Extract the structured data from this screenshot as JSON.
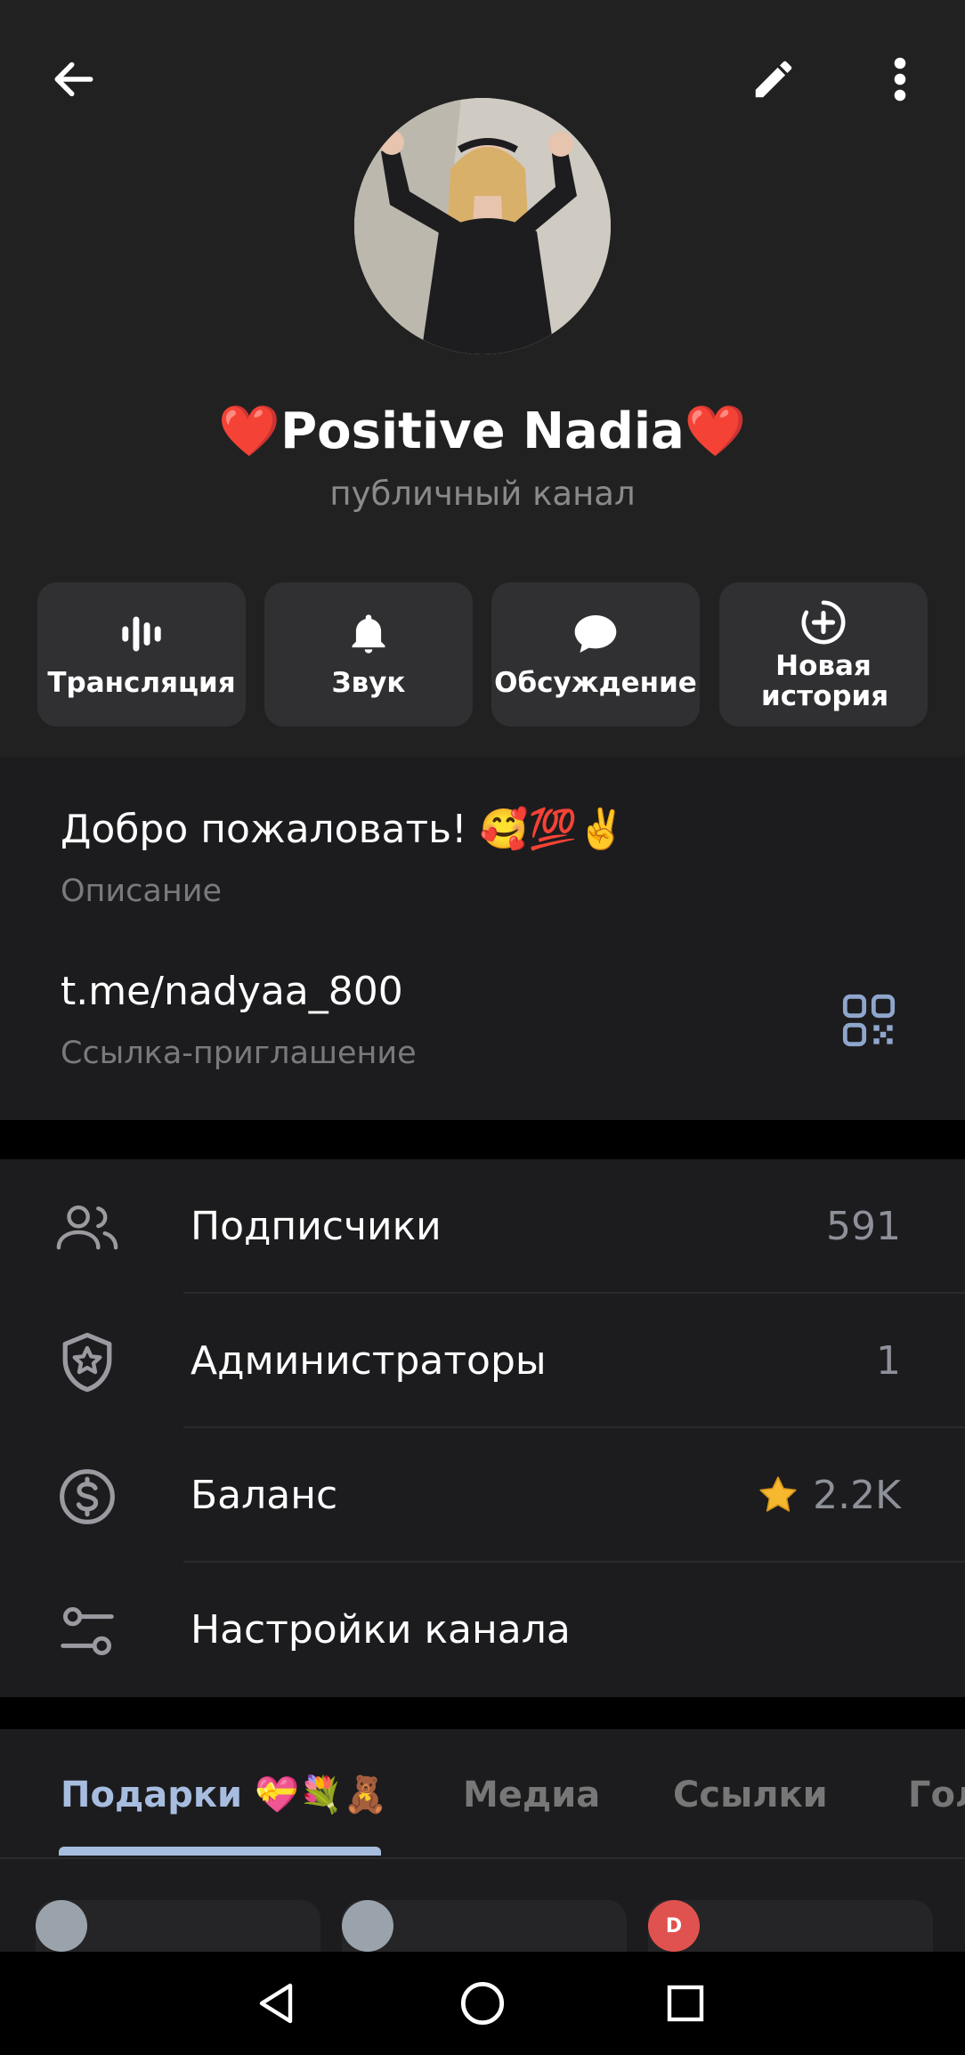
{
  "channel": {
    "name": "❤️Positive Nadia❤️",
    "type": "публичный канал"
  },
  "actions": [
    {
      "label": "Трансляция",
      "icon": "live-stream-icon"
    },
    {
      "label": "Звук",
      "icon": "bell-icon"
    },
    {
      "label": "Обсуждение",
      "icon": "chat-bubble-icon"
    },
    {
      "label": "Новая история",
      "icon": "add-story-icon"
    }
  ],
  "info": {
    "description": "Добро пожаловать! 🥰💯✌️",
    "description_label": "Описание",
    "link": "t.me/nadyaa_800",
    "link_label": "Ссылка-приглашение"
  },
  "list": [
    {
      "label": "Подписчики",
      "value": "591",
      "icon": "users-icon"
    },
    {
      "label": "Администраторы",
      "value": "1",
      "icon": "shield-star-icon"
    },
    {
      "label": "Баланс",
      "value": "2.2K",
      "icon": "dollar-icon"
    },
    {
      "label": "Настройки канала",
      "value": "",
      "icon": "sliders-icon"
    }
  ],
  "tabs": [
    {
      "label": "Подарки 💝💐🧸",
      "active": true
    },
    {
      "label": "Медиа",
      "active": false
    },
    {
      "label": "Ссылки",
      "active": false
    },
    {
      "label": "Гол",
      "active": false
    }
  ],
  "gifts": [
    {
      "avatar_letter": ""
    },
    {
      "avatar_letter": ""
    },
    {
      "avatar_letter": "D"
    }
  ],
  "colors": {
    "background": "#212121",
    "section": "#1c1c1e",
    "accent": "#a7bde0",
    "secondary_text": "#8a8a8a"
  }
}
